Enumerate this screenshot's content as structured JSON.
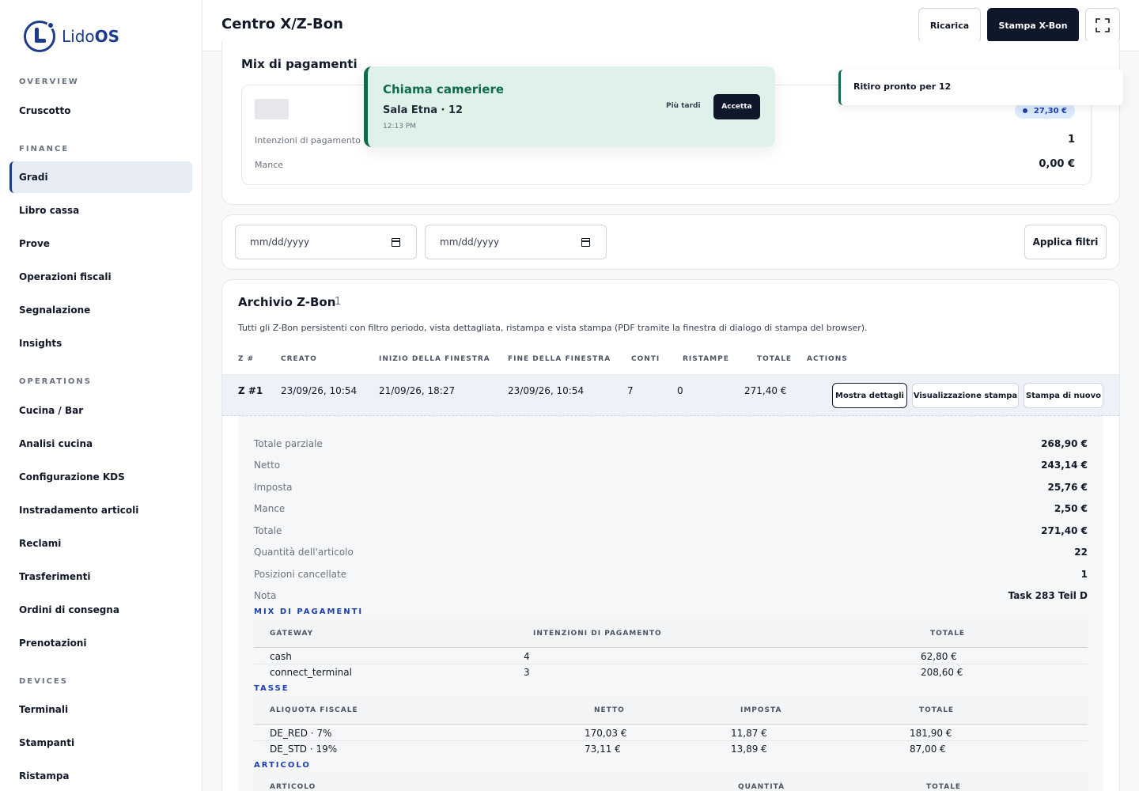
{
  "app": {
    "logo_text_a": "Lido",
    "logo_text_b": "OS"
  },
  "sidebar": {
    "sections": [
      {
        "title": "OVERVIEW",
        "items": [
          "Cruscotto"
        ]
      },
      {
        "title": "FINANCE",
        "items": [
          "Gradi",
          "Libro cassa",
          "Prove",
          "Operazioni fiscali",
          "Segnalazione",
          "Insights"
        ]
      },
      {
        "title": "OPERATIONS",
        "items": [
          "Cucina / Bar",
          "Analisi cucina",
          "Configurazione KDS",
          "Instradamento articoli",
          "Reclami",
          "Trasferimenti",
          "Ordini di consegna",
          "Prenotazioni"
        ]
      },
      {
        "title": "DEVICES",
        "items": [
          "Terminali",
          "Stampanti",
          "Ristampa"
        ]
      }
    ],
    "active": "Gradi"
  },
  "header": {
    "title": "Centro X/Z-Bon",
    "reload_label": "Ricarica",
    "print_x_label": "Stampa X-Bon",
    "fullscreen_icon": "fullscreen-icon"
  },
  "payment_mix": {
    "title": "Mix di pagamenti",
    "badge": "27,30 €",
    "rows": [
      {
        "label": "Intenzioni di pagamento",
        "value": "1"
      },
      {
        "label": "Mance",
        "value": "0,00 €"
      }
    ]
  },
  "toast_call": {
    "title": "Chiama cameriere",
    "subtitle": "Sala Etna · 12",
    "time": "12:13 PM",
    "later_label": "Più tardi",
    "accept_label": "Accetta"
  },
  "toast_ready": {
    "text": "Ritiro pronto per 12"
  },
  "filters": {
    "from_placeholder": "mm/dd/yyyy",
    "to_placeholder": "mm/dd/yyyy",
    "apply_label": "Applica filtri"
  },
  "archive": {
    "title": "Archivio Z-Bon",
    "count": "1",
    "description": "Tutti gli Z-Bon persistenti con filtro periodo, vista dettagliata, ristampa e vista stampa (PDF tramite la finestra di dialogo di stampa del browser).",
    "columns": [
      "Z #",
      "CREATO",
      "INIZIO DELLA FINESTRA",
      "FINE DELLA FINESTRA",
      "CONTI",
      "RISTAMPE",
      "TOTALE",
      "ACTIONS"
    ],
    "row": {
      "z": "Z #1",
      "created": "23/09/26, 10:54",
      "start": "21/09/26, 18:27",
      "end": "23/09/26, 10:54",
      "accounts": "7",
      "reprints": "0",
      "total": "271,40 €"
    },
    "actions": {
      "details": "Mostra dettagli",
      "print_view": "Visualizzazione stampa",
      "reprint": "Stampa di nuovo"
    }
  },
  "details": {
    "summary": [
      {
        "label": "Totale parziale",
        "value": "268,90 €"
      },
      {
        "label": "Netto",
        "value": "243,14 €"
      },
      {
        "label": "Imposta",
        "value": "25,76 €"
      },
      {
        "label": "Mance",
        "value": "2,50 €"
      },
      {
        "label": "Totale",
        "value": "271,40 €"
      },
      {
        "label": "Quantità dell'articolo",
        "value": "22"
      },
      {
        "label": "Posizioni cancellate",
        "value": "1"
      },
      {
        "label": "Nota",
        "value": "Task 283 Teil D"
      }
    ],
    "payment_section": {
      "title": "MIX DI PAGAMENTI",
      "columns": [
        "GATEWAY",
        "INTENZIONI DI PAGAMENTO",
        "TOTALE"
      ],
      "rows": [
        [
          "cash",
          "4",
          "62,80 €"
        ],
        [
          "connect_terminal",
          "3",
          "208,60 €"
        ]
      ]
    },
    "tax_section": {
      "title": "TASSE",
      "columns": [
        "ALIQUOTA FISCALE",
        "NETTO",
        "IMPOSTA",
        "TOTALE"
      ],
      "rows": [
        [
          "DE_RED · 7%",
          "170,03 €",
          "11,87 €",
          "181,90 €"
        ],
        [
          "DE_STD · 19%",
          "73,11 €",
          "13,89 €",
          "87,00 €"
        ]
      ]
    },
    "article_section": {
      "title": "ARTICOLO",
      "columns": [
        "ARTICOLO",
        "QUANTITÀ",
        "TOTALE"
      ]
    }
  }
}
